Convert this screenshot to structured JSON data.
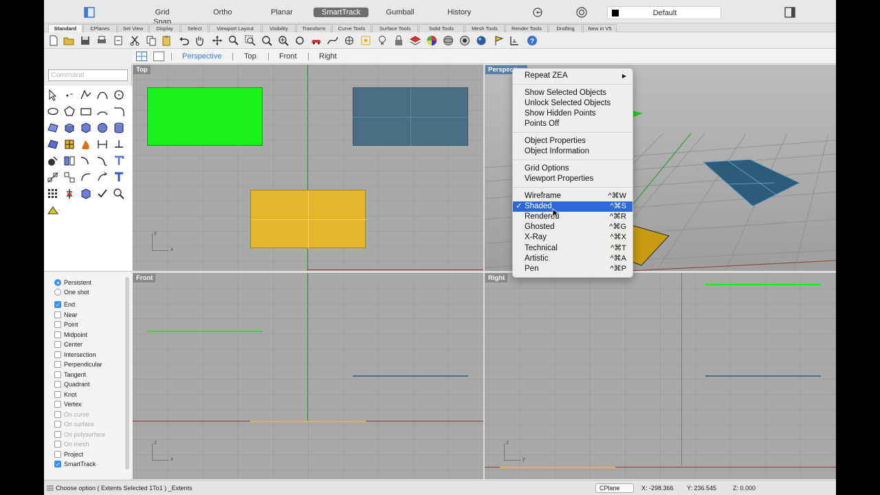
{
  "topbar": {
    "toggles": [
      "Grid Snap",
      "Ortho",
      "Planar",
      "SmartTrack",
      "Gumball",
      "History"
    ],
    "layer_name": "Default",
    "layer_color": "#000000"
  },
  "tabs": [
    "Standard",
    "CPlanes",
    "Set View",
    "Display",
    "Select",
    "Viewport Layout",
    "Visibility",
    "Transform",
    "Curve Tools",
    "Surface Tools",
    "Solid Tools",
    "Mesh Tools",
    "Render Tools",
    "Drafting",
    "New in V5"
  ],
  "viewport_tabs": [
    "Perspective",
    "Top",
    "Front",
    "Right"
  ],
  "command": {
    "placeholder": "Command"
  },
  "osnap": {
    "modes": [
      "Persistent",
      "One shot"
    ],
    "items": [
      {
        "label": "End",
        "checked": true,
        "enabled": true
      },
      {
        "label": "Near",
        "checked": false,
        "enabled": true
      },
      {
        "label": "Point",
        "checked": false,
        "enabled": true
      },
      {
        "label": "Midpoint",
        "checked": false,
        "enabled": true
      },
      {
        "label": "Center",
        "checked": false,
        "enabled": true
      },
      {
        "label": "Intersection",
        "checked": false,
        "enabled": true
      },
      {
        "label": "Perpendicular",
        "checked": false,
        "enabled": true
      },
      {
        "label": "Tangent",
        "checked": false,
        "enabled": true
      },
      {
        "label": "Quadrant",
        "checked": false,
        "enabled": true
      },
      {
        "label": "Knot",
        "checked": false,
        "enabled": true
      },
      {
        "label": "Vertex",
        "checked": false,
        "enabled": true
      },
      {
        "label": "On curve",
        "checked": false,
        "enabled": false
      },
      {
        "label": "On surface",
        "checked": false,
        "enabled": false
      },
      {
        "label": "On polysurface",
        "checked": false,
        "enabled": false
      },
      {
        "label": "On mesh",
        "checked": false,
        "enabled": false
      },
      {
        "label": "Project",
        "checked": false,
        "enabled": true
      },
      {
        "label": "SmartTrack",
        "checked": true,
        "enabled": true
      }
    ]
  },
  "viewports": {
    "top": {
      "label": "Top",
      "axis_y": "y",
      "axis_x": "x"
    },
    "perspective": {
      "label": "Perspective"
    },
    "front": {
      "label": "Front",
      "axis_y": "z",
      "axis_x": "x"
    },
    "right": {
      "label": "Right",
      "axis_y": "z",
      "axis_x": "y"
    }
  },
  "colors": {
    "green_object": "#19f01a",
    "blue_object": "#4b6f82",
    "yellow_object": "#e2b62a",
    "menu_selection": "#2c68d8",
    "viewport_bg": "#a9a9a9"
  },
  "context_menu": {
    "items": [
      {
        "label": "Repeat ZEA",
        "shortcut": "",
        "submenu": true
      },
      {
        "label": "Show Selected Objects",
        "shortcut": ""
      },
      {
        "label": "Unlock Selected Objects",
        "shortcut": ""
      },
      {
        "label": "Show Hidden Points",
        "shortcut": ""
      },
      {
        "label": "Points Off",
        "shortcut": ""
      },
      {
        "label": "Object Properties",
        "shortcut": ""
      },
      {
        "label": "Object Information",
        "shortcut": ""
      },
      {
        "label": "Grid Options",
        "shortcut": ""
      },
      {
        "label": "Viewport Properties",
        "shortcut": ""
      },
      {
        "label": "Wireframe",
        "shortcut": "^⌘W"
      },
      {
        "label": "Shaded",
        "shortcut": "^⌘S",
        "checked": true,
        "selected": true
      },
      {
        "label": "Rendered",
        "shortcut": "^⌘R"
      },
      {
        "label": "Ghosted",
        "shortcut": "^⌘G"
      },
      {
        "label": "X-Ray",
        "shortcut": "^⌘X"
      },
      {
        "label": "Technical",
        "shortcut": "^⌘T"
      },
      {
        "label": "Artistic",
        "shortcut": "^⌘A"
      },
      {
        "label": "Pen",
        "shortcut": "^⌘P"
      }
    ]
  },
  "status": {
    "prompt": "Choose option ( Extents Selected 1To1 ) _Extents",
    "cplane": "CPlane",
    "x": "X: -298.366",
    "y": "Y: 236.545",
    "z": "Z: 0.000"
  }
}
